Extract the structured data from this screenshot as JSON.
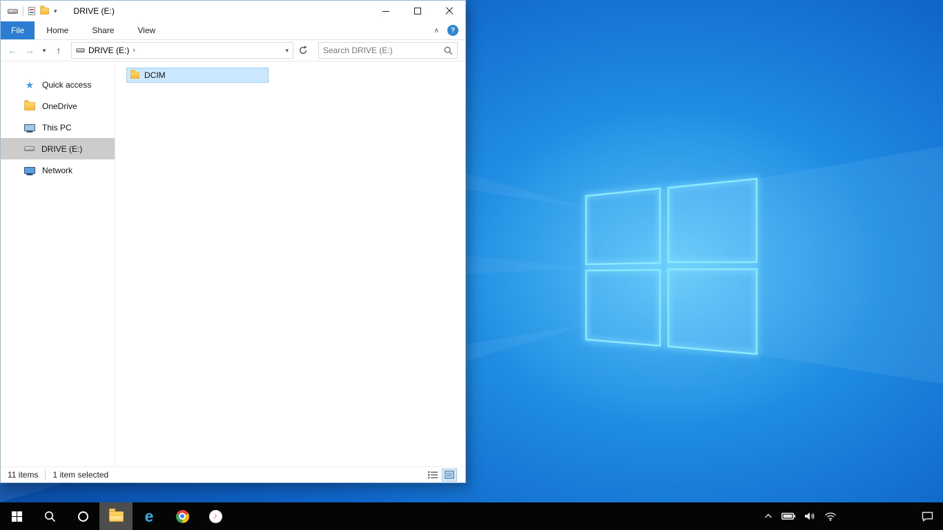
{
  "colors": {
    "accent_blue": "#2b7cd3",
    "file_selection_bg": "#cce8ff",
    "file_selection_border": "#99d1ff",
    "sidebar_selected_bg": "#cccccc",
    "taskbar_bg": "#050505",
    "wallpaper_glow": "#41b2f2"
  },
  "titlebar": {
    "title": "DRIVE (E:)"
  },
  "ribbon": {
    "tabs": [
      {
        "label": "File"
      },
      {
        "label": "Home"
      },
      {
        "label": "Share"
      },
      {
        "label": "View"
      }
    ],
    "help_label": "?"
  },
  "navbar": {
    "breadcrumb": [
      {
        "label": "DRIVE (E:)"
      }
    ],
    "search_placeholder": "Search DRIVE (E:)"
  },
  "sidebar": {
    "items": [
      {
        "label": "Quick access",
        "icon": "star-icon"
      },
      {
        "label": "OneDrive",
        "icon": "folder-icon"
      },
      {
        "label": "This PC",
        "icon": "computer-icon"
      },
      {
        "label": "DRIVE (E:)",
        "icon": "drive-icon",
        "selected": true
      },
      {
        "label": "Network",
        "icon": "network-icon"
      }
    ]
  },
  "content": {
    "items": [
      {
        "label": "DCIM",
        "icon": "folder-icon",
        "selected": true
      }
    ]
  },
  "statusbar": {
    "item_count": "11 items",
    "selection": "1 item selected"
  },
  "taskbar": {
    "apps": [
      {
        "name": "start"
      },
      {
        "name": "search"
      },
      {
        "name": "cortana"
      },
      {
        "name": "file-explorer",
        "active": true
      },
      {
        "name": "internet-explorer",
        "glyph": "e"
      },
      {
        "name": "chrome"
      },
      {
        "name": "itunes",
        "glyph": "♪"
      }
    ]
  }
}
